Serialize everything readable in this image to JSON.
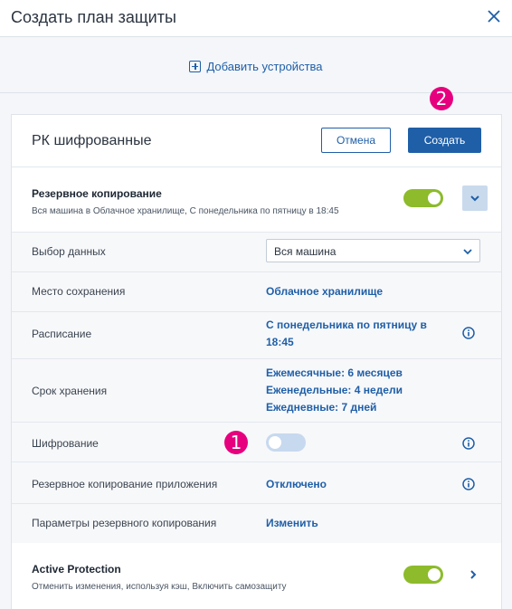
{
  "header": {
    "title": "Создать план защиты"
  },
  "add_devices": {
    "label": "Добавить устройства"
  },
  "plan": {
    "name": "РК шифрованные",
    "cancel_label": "Отмена",
    "create_label": "Создать"
  },
  "backup_module": {
    "title": "Резервное копирование",
    "summary": "Вся машина в Облачное хранилище, С понедельника по пятницу в 18:45",
    "enabled": true
  },
  "settings": {
    "data_selection": {
      "label": "Выбор данных",
      "value": "Вся машина"
    },
    "destination": {
      "label": "Место сохранения",
      "value": "Облачное хранилище"
    },
    "schedule": {
      "label": "Расписание",
      "value_line1": "С понедельника по пятницу в",
      "value_line2": "18:45"
    },
    "retention": {
      "label": "Срок хранения",
      "monthly": "Ежемесячные: 6 месяцев",
      "weekly": "Еженедельные: 4 недели",
      "daily": "Ежедневные: 7 дней"
    },
    "encryption": {
      "label": "Шифрование",
      "enabled": false
    },
    "app_backup": {
      "label": "Резервное копирование приложения",
      "value": "Отключено"
    },
    "backup_options": {
      "label": "Параметры резервного копирования",
      "value": "Изменить"
    }
  },
  "active_protection": {
    "title": "Active Protection",
    "summary": "Отменить изменения, используя кэш, Включить самозащиту",
    "enabled": true
  },
  "annotations": {
    "step1": "1",
    "step2": "2"
  },
  "colors": {
    "accent": "#1f5fa8",
    "toggle_on": "#8dbb2b",
    "toggle_off": "#c7d9ef",
    "badge": "#e6007e"
  }
}
